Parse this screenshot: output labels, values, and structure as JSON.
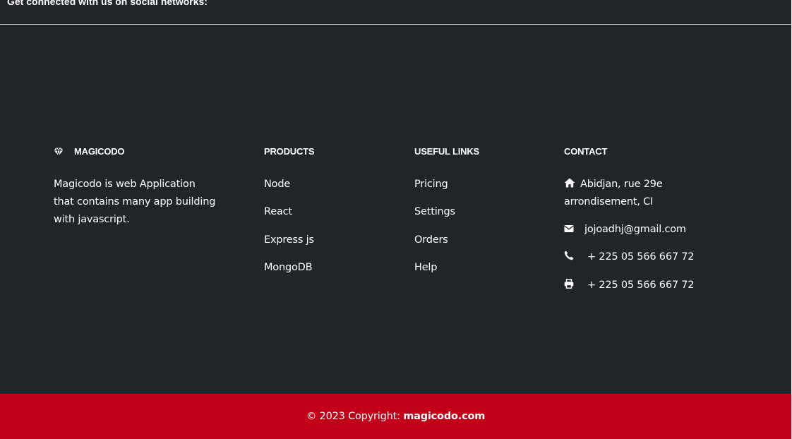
{
  "social": {
    "text": "Get connected with us on social networks:"
  },
  "brand": {
    "icon": "gem-icon",
    "name": "MAGICODO",
    "description": "Magicodo is web Application that contains many app building with javascript."
  },
  "products": {
    "heading": "PRODUCTS",
    "items": [
      "Node",
      "React",
      "Express js",
      "MongoDB"
    ]
  },
  "useful_links": {
    "heading": "USEFUL LINKS",
    "items": [
      "Pricing",
      "Settings",
      "Orders",
      "Help"
    ]
  },
  "contact": {
    "heading": "CONTACT",
    "address_line1": "Abidjan, rue 29e",
    "address_line2": "arrondisement, CI",
    "address_icon": "home-icon",
    "email": "jojoadhj@gmail.com",
    "email_icon": "envelope-icon",
    "phone": "+ 225 05 566 667 72",
    "phone_icon": "phone-icon",
    "fax": "+ 225 05 566 667 72",
    "fax_icon": "printer-icon"
  },
  "copyright": {
    "prefix": "© 2023 Copyright: ",
    "link_text": "magicodo.com"
  },
  "colors": {
    "background": "#212529",
    "accent": "#c20017",
    "text": "#ffffff"
  }
}
